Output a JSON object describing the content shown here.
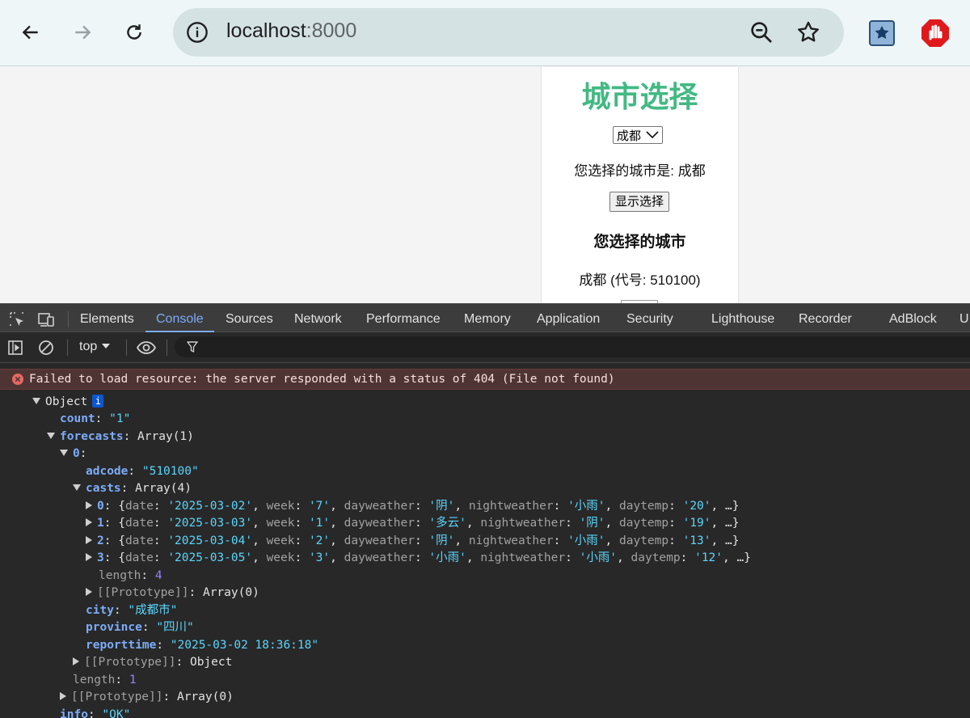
{
  "browser": {
    "url_host": "localhost",
    "url_port": ":8000"
  },
  "page": {
    "title": "城市选择",
    "select_value": "成都",
    "selected_text": "您选择的城市是: 成都",
    "show_button": "显示选择",
    "sub_heading": "您选择的城市",
    "code_text": "成都 (代号: 510100)"
  },
  "devtools": {
    "tabs": [
      "Elements",
      "Console",
      "Sources",
      "Network",
      "Performance",
      "Memory",
      "Application",
      "Security",
      "Lighthouse",
      "Recorder",
      "AdBlock",
      "U"
    ],
    "active_tab": "Console",
    "context": "top",
    "error_message": "Failed to load resource: the server responded with a status of 404 (File not found)",
    "tree": {
      "root_label": "Object",
      "count_key": "count",
      "count_val": "\"1\"",
      "forecasts_key": "forecasts",
      "forecasts_type": "Array(1)",
      "index0": "0",
      "adcode_key": "adcode",
      "adcode_val": "\"510100\"",
      "casts_key": "casts",
      "casts_type": "Array(4)",
      "casts": [
        {
          "idx": "0",
          "date": "'2025-03-02'",
          "week": "'7'",
          "dayweather": "'阴'",
          "nightweather": "'小雨'",
          "daytemp": "'20'"
        },
        {
          "idx": "1",
          "date": "'2025-03-03'",
          "week": "'1'",
          "dayweather": "'多云'",
          "nightweather": "'阴'",
          "daytemp": "'19'"
        },
        {
          "idx": "2",
          "date": "'2025-03-04'",
          "week": "'2'",
          "dayweather": "'阴'",
          "nightweather": "'小雨'",
          "daytemp": "'13'"
        },
        {
          "idx": "3",
          "date": "'2025-03-05'",
          "week": "'3'",
          "dayweather": "'小雨'",
          "nightweather": "'小雨'",
          "daytemp": "'12'"
        }
      ],
      "length_key": "length",
      "casts_length": "4",
      "proto_key": "[[Prototype]]",
      "proto_array0": "Array(0)",
      "proto_object": "Object",
      "city_key": "city",
      "city_val": "\"成都市\"",
      "province_key": "province",
      "province_val": "\"四川\"",
      "reporttime_key": "reporttime",
      "reporttime_val": "\"2025-03-02 18:36:18\"",
      "forecasts_length": "1",
      "info_key": "info",
      "info_val": "\"OK\""
    }
  }
}
